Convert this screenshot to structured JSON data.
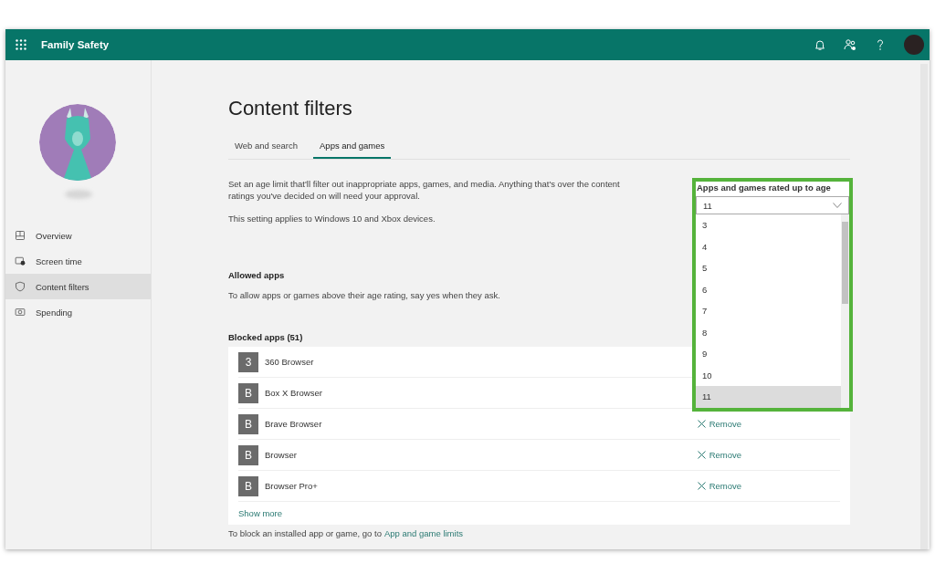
{
  "header": {
    "title": "Family Safety"
  },
  "sidebar": {
    "items": [
      {
        "label": "Overview",
        "selected": false
      },
      {
        "label": "Screen time",
        "selected": false
      },
      {
        "label": "Content filters",
        "selected": true
      },
      {
        "label": "Spending",
        "selected": false
      }
    ]
  },
  "page": {
    "title": "Content filters",
    "tabs": [
      {
        "label": "Web and search",
        "selected": false
      },
      {
        "label": "Apps and games",
        "selected": true
      }
    ],
    "description": "Set an age limit that'll filter out inappropriate apps, games, and media. Anything that's over the content ratings you've decided on will need your approval.",
    "note": "This setting applies to Windows 10 and Xbox devices.",
    "allowed": {
      "heading": "Allowed apps",
      "text": "To allow apps or games above their age rating, say yes when they ask."
    },
    "blocked": {
      "heading": "Blocked apps (51)",
      "apps": [
        {
          "initial": "3",
          "name": "360 Browser"
        },
        {
          "initial": "B",
          "name": "Box X Browser"
        },
        {
          "initial": "B",
          "name": "Brave Browser",
          "remove": "Remove"
        },
        {
          "initial": "B",
          "name": "Browser",
          "remove": "Remove"
        },
        {
          "initial": "B",
          "name": "Browser Pro+",
          "remove": "Remove"
        }
      ],
      "show_more": "Show more"
    },
    "footer": {
      "text": "To block an installed app or game, go to ",
      "link": "App and game limits"
    },
    "age_select": {
      "label": "Apps and games rated up to age",
      "value": "11",
      "options": [
        {
          "label": "3",
          "selected": false
        },
        {
          "label": "4",
          "selected": false
        },
        {
          "label": "5",
          "selected": false
        },
        {
          "label": "6",
          "selected": false
        },
        {
          "label": "7",
          "selected": false
        },
        {
          "label": "8",
          "selected": false
        },
        {
          "label": "9",
          "selected": false
        },
        {
          "label": "10",
          "selected": false
        },
        {
          "label": "11",
          "selected": true
        }
      ]
    }
  }
}
